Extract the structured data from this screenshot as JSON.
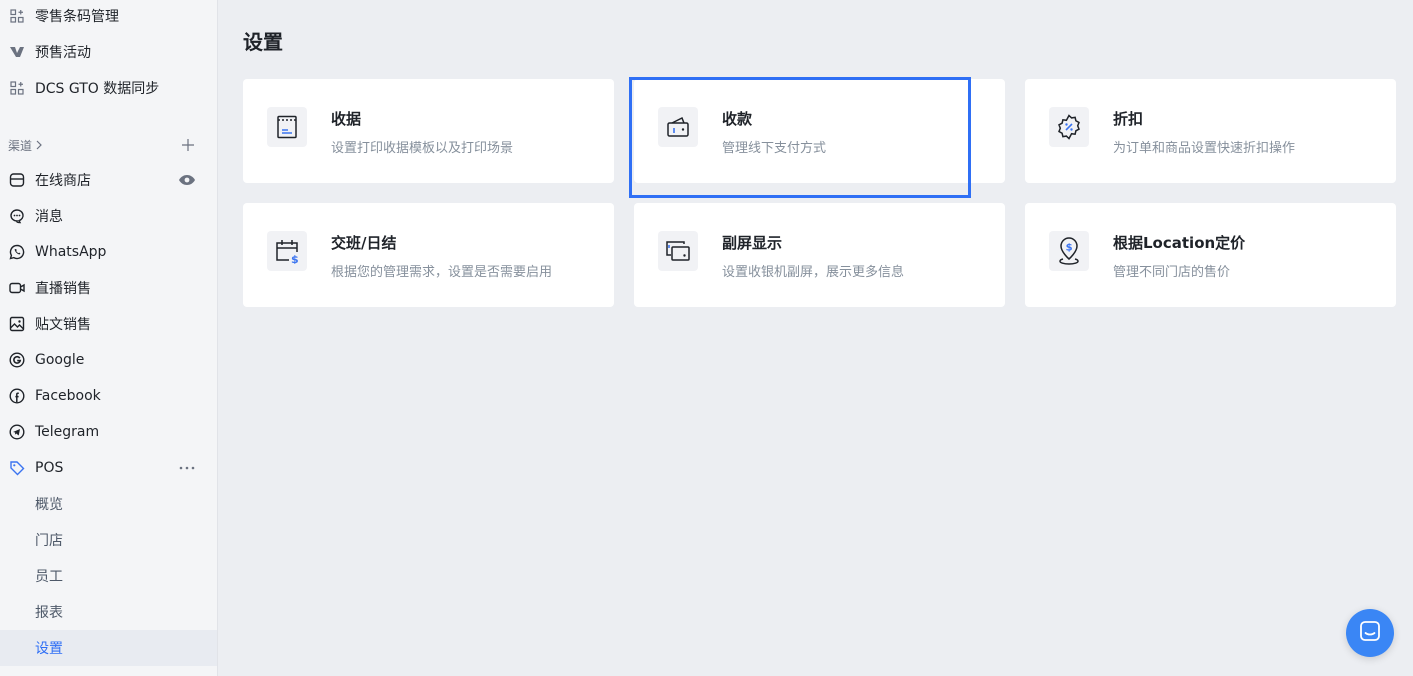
{
  "sidebar": {
    "top_items": [
      {
        "label": "零售条码管理",
        "icon": "grid-apps-icon"
      },
      {
        "label": "预售活动",
        "icon": "presale-tag-icon"
      },
      {
        "label": "DCS GTO 数据同步",
        "icon": "grid-apps-icon"
      }
    ],
    "section_label": "渠道",
    "channels": [
      {
        "label": "在线商店",
        "icon": "storefront-icon",
        "right_icon": "eye-icon"
      },
      {
        "label": "消息",
        "icon": "chat-bubble-icon"
      },
      {
        "label": "WhatsApp",
        "icon": "whatsapp-icon"
      },
      {
        "label": "直播销售",
        "icon": "video-icon"
      },
      {
        "label": "贴文销售",
        "icon": "image-post-icon"
      },
      {
        "label": "Google",
        "icon": "google-icon"
      },
      {
        "label": "Facebook",
        "icon": "facebook-icon"
      },
      {
        "label": "Telegram",
        "icon": "telegram-icon"
      },
      {
        "label": "POS",
        "icon": "pos-tag-icon",
        "right_icon": "more-icon"
      }
    ],
    "pos_sub": [
      {
        "label": "概览"
      },
      {
        "label": "门店"
      },
      {
        "label": "员工"
      },
      {
        "label": "报表"
      },
      {
        "label": "设置",
        "active": true
      }
    ]
  },
  "main": {
    "title": "设置",
    "cards": [
      {
        "title": "收据",
        "desc": "设置打印收据模板以及打印场景",
        "icon": "receipt-icon"
      },
      {
        "title": "收款",
        "desc": "管理线下支付方式",
        "icon": "wallet-icon"
      },
      {
        "title": "折扣",
        "desc": "为订单和商品设置快速折扣操作",
        "icon": "discount-badge-icon"
      },
      {
        "title": "交班/日结",
        "desc": "根据您的管理需求，设置是否需要启用",
        "icon": "calendar-dollar-icon"
      },
      {
        "title": "副屏显示",
        "desc": "设置收银机副屏，展示更多信息",
        "icon": "second-screen-icon"
      },
      {
        "title": "根据Location定价",
        "desc": "管理不同门店的售价",
        "icon": "location-price-icon"
      }
    ]
  },
  "colors": {
    "accent": "#2f6ff5",
    "icon_blue": "#3b74f0",
    "chat_button": "#3a86f5"
  }
}
